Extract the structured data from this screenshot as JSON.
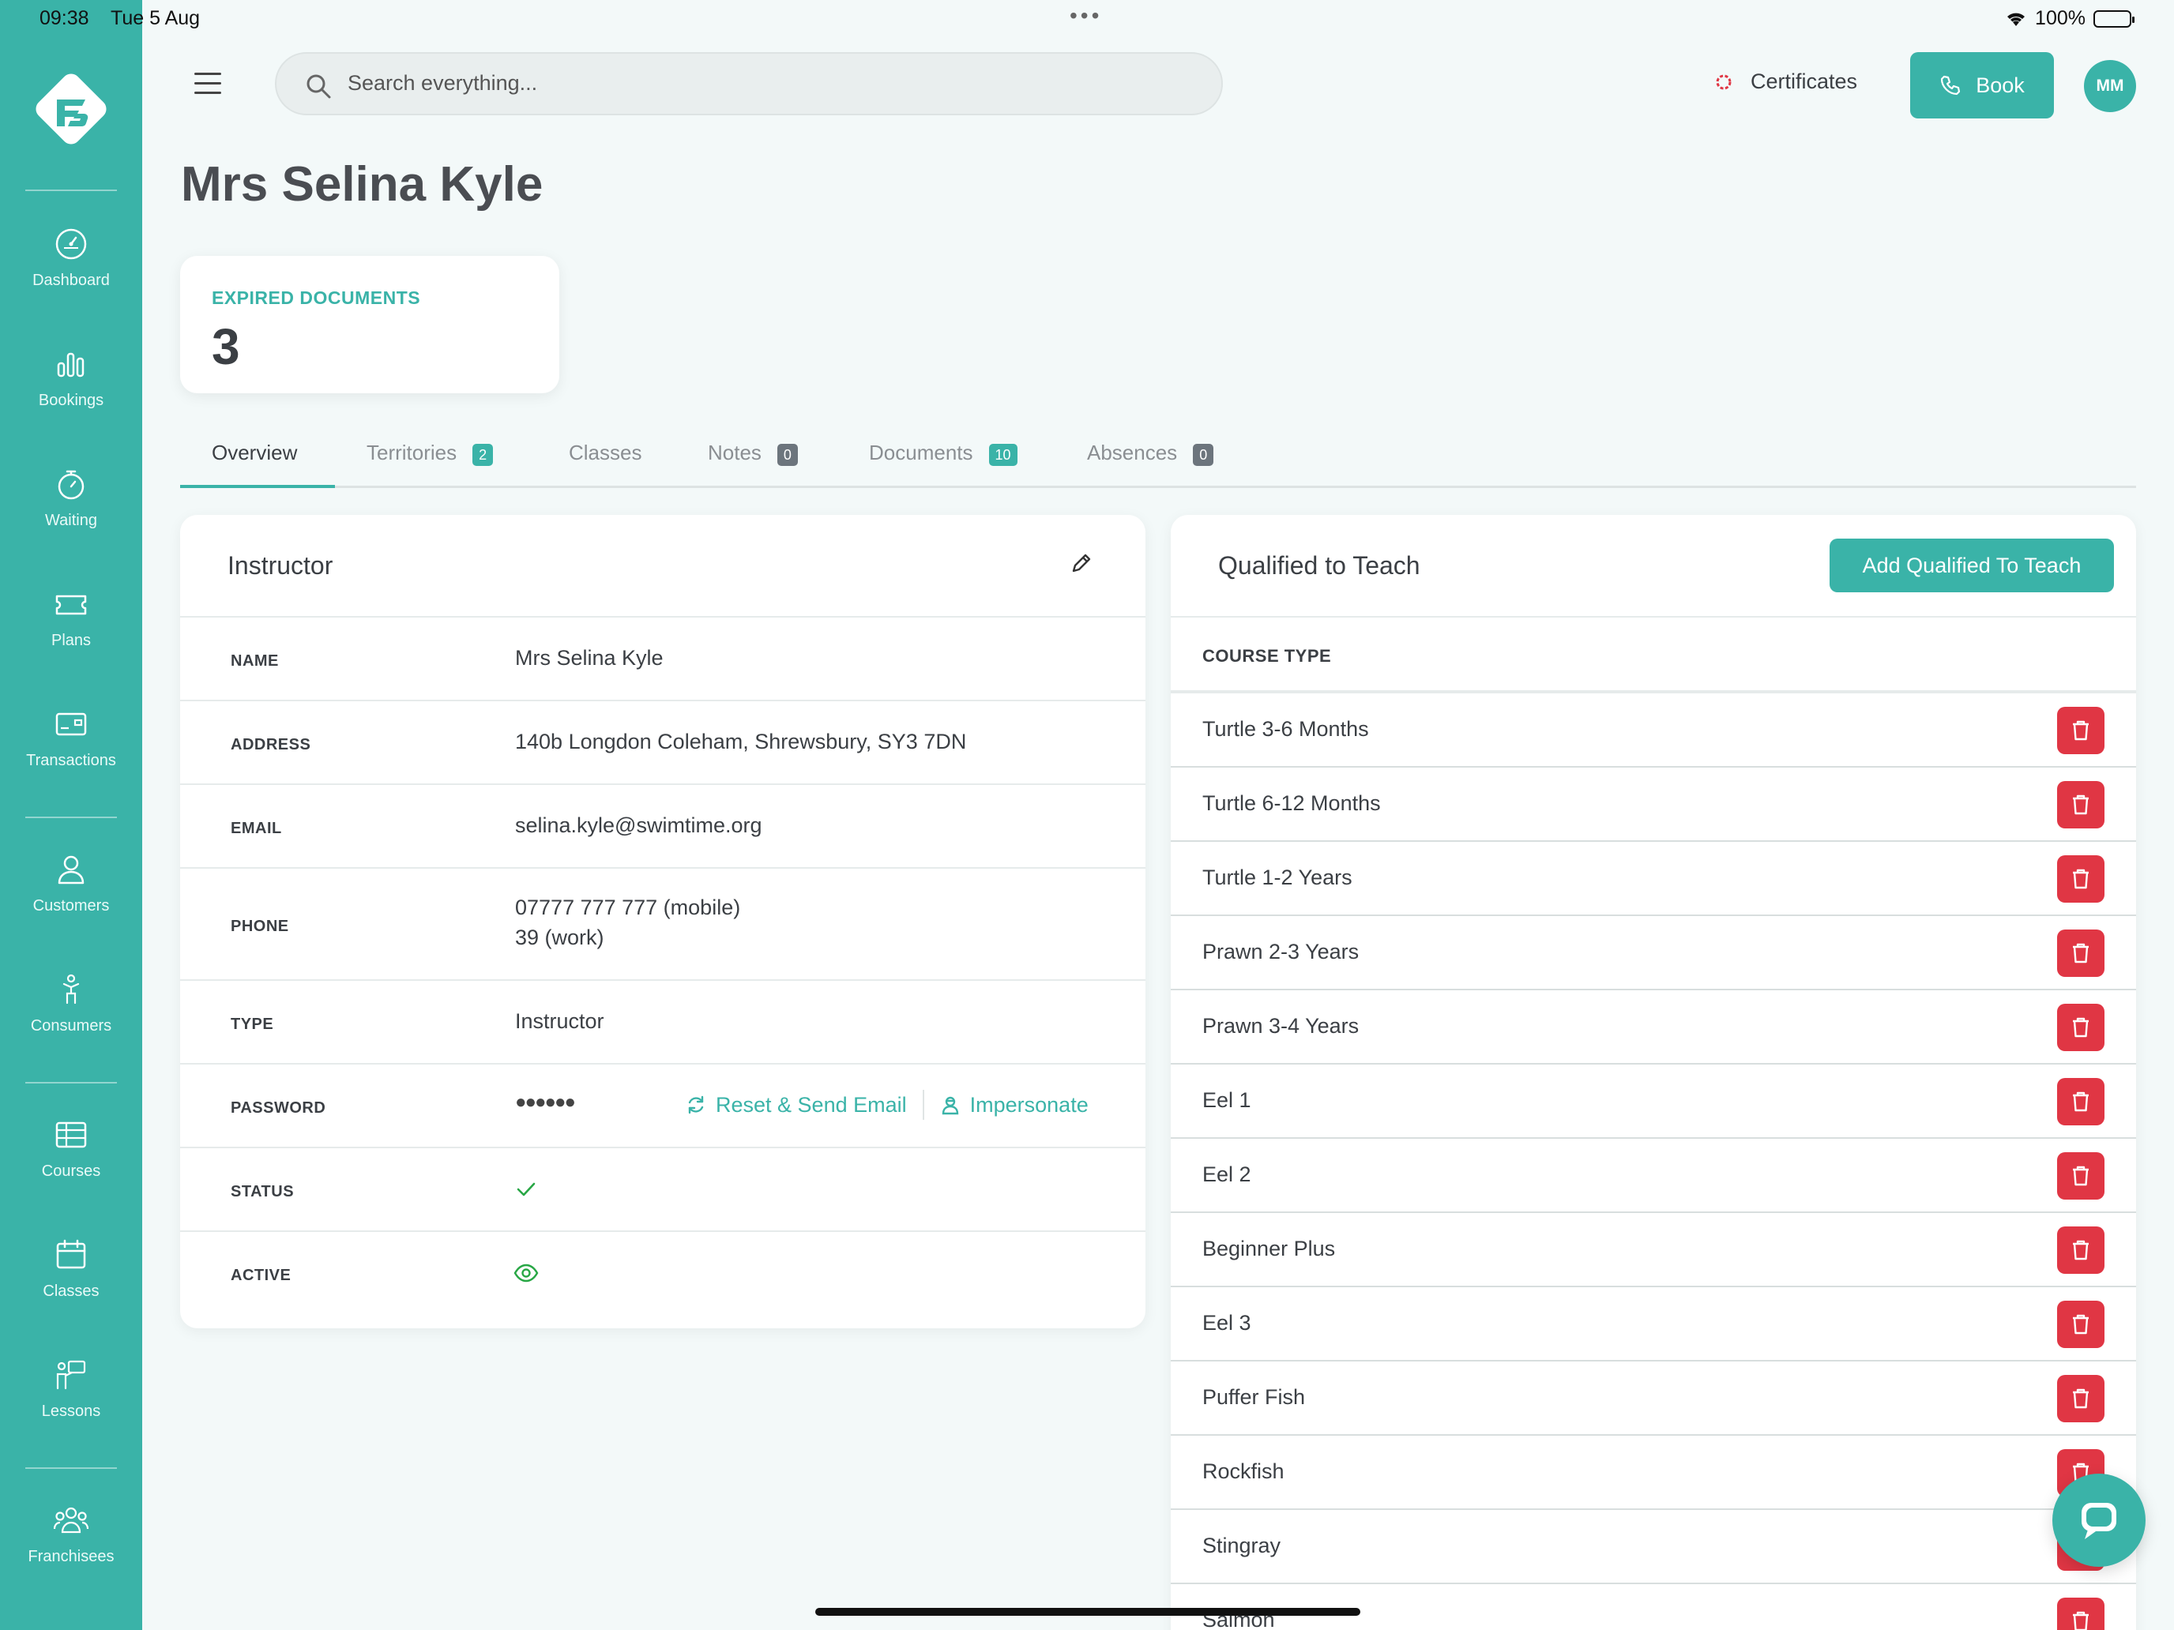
{
  "status_bar": {
    "time": "09:38",
    "date": "Tue 5 Aug",
    "battery": "100%"
  },
  "sidebar": {
    "items": [
      {
        "label": "Dashboard",
        "icon": "dashboard-gauge-icon"
      },
      {
        "label": "Bookings",
        "icon": "bar-chart-icon"
      },
      {
        "label": "Waiting",
        "icon": "stopwatch-icon"
      },
      {
        "label": "Plans",
        "icon": "ticket-icon"
      },
      {
        "label": "Transactions",
        "icon": "card-icon"
      },
      {
        "label": "Customers",
        "icon": "user-icon"
      },
      {
        "label": "Consumers",
        "icon": "child-icon"
      },
      {
        "label": "Courses",
        "icon": "table-icon"
      },
      {
        "label": "Classes",
        "icon": "calendar-icon"
      },
      {
        "label": "Lessons",
        "icon": "teacher-board-icon"
      },
      {
        "label": "Franchisees",
        "icon": "users-group-icon"
      }
    ]
  },
  "header": {
    "search_placeholder": "Search everything...",
    "certificates_label": "Certificates",
    "book_label": "Book",
    "avatar_initials": "MM"
  },
  "page": {
    "title": "Mrs Selina Kyle",
    "stat": {
      "label": "EXPIRED DOCUMENTS",
      "value": "3"
    }
  },
  "tabs": [
    {
      "label": "Overview",
      "badge": ""
    },
    {
      "label": "Territories",
      "badge": "2"
    },
    {
      "label": "Classes",
      "badge": ""
    },
    {
      "label": "Notes",
      "badge": "0"
    },
    {
      "label": "Documents",
      "badge": "10"
    },
    {
      "label": "Absences",
      "badge": "0"
    }
  ],
  "instructor": {
    "title": "Instructor",
    "name_label": "NAME",
    "name": "Mrs Selina Kyle",
    "address_label": "ADDRESS",
    "address": "140b Longdon Coleham, Shrewsbury, SY3 7DN",
    "email_label": "EMAIL",
    "email": "selina.kyle@swimtime.org",
    "phone_label": "PHONE",
    "phone_mobile": "07777 777 777 (mobile)",
    "phone_work": "39 (work)",
    "type_label": "TYPE",
    "type": "Instructor",
    "password_label": "PASSWORD",
    "password_mask": "●●●●●●",
    "reset_label": "Reset & Send Email",
    "impersonate_label": "Impersonate",
    "status_label": "STATUS",
    "active_label": "ACTIVE"
  },
  "qualified": {
    "title": "Qualified to Teach",
    "add_label": "Add Qualified To Teach",
    "column": "COURSE TYPE",
    "rows": [
      "Turtle 3-6 Months",
      "Turtle 6-12 Months",
      "Turtle 1-2 Years",
      "Prawn 2-3 Years",
      "Prawn 3-4 Years",
      "Eel 1",
      "Eel 2",
      "Beginner Plus",
      "Eel 3",
      "Puffer Fish",
      "Rockfish",
      "Stingray",
      "Salmon"
    ]
  },
  "colors": {
    "accent": "#3ab3a8",
    "danger": "#e03644",
    "status_ok": "#28a745"
  }
}
